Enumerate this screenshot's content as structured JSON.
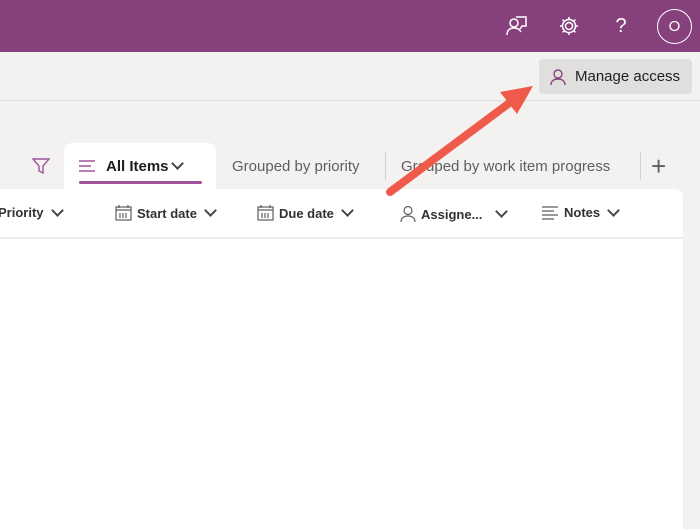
{
  "topbar": {
    "icons": [
      "feedback-icon",
      "settings-icon",
      "help-icon"
    ],
    "help_glyph": "?",
    "avatar_initial": "O",
    "color": "#86417c"
  },
  "command_bar": {
    "manage_access": "Manage access"
  },
  "views": {
    "tabs": [
      {
        "label": "All Items",
        "active": true
      },
      {
        "label": "Grouped by priority"
      },
      {
        "label": "Grouped by work item progress"
      }
    ],
    "add_glyph": "+"
  },
  "columns": [
    {
      "label": "Priority"
    },
    {
      "label": "Start date"
    },
    {
      "label": "Due date"
    },
    {
      "label": "Assigne..."
    },
    {
      "label": "Notes"
    }
  ],
  "annotation": {
    "arrow_color": "#f05a4a"
  }
}
